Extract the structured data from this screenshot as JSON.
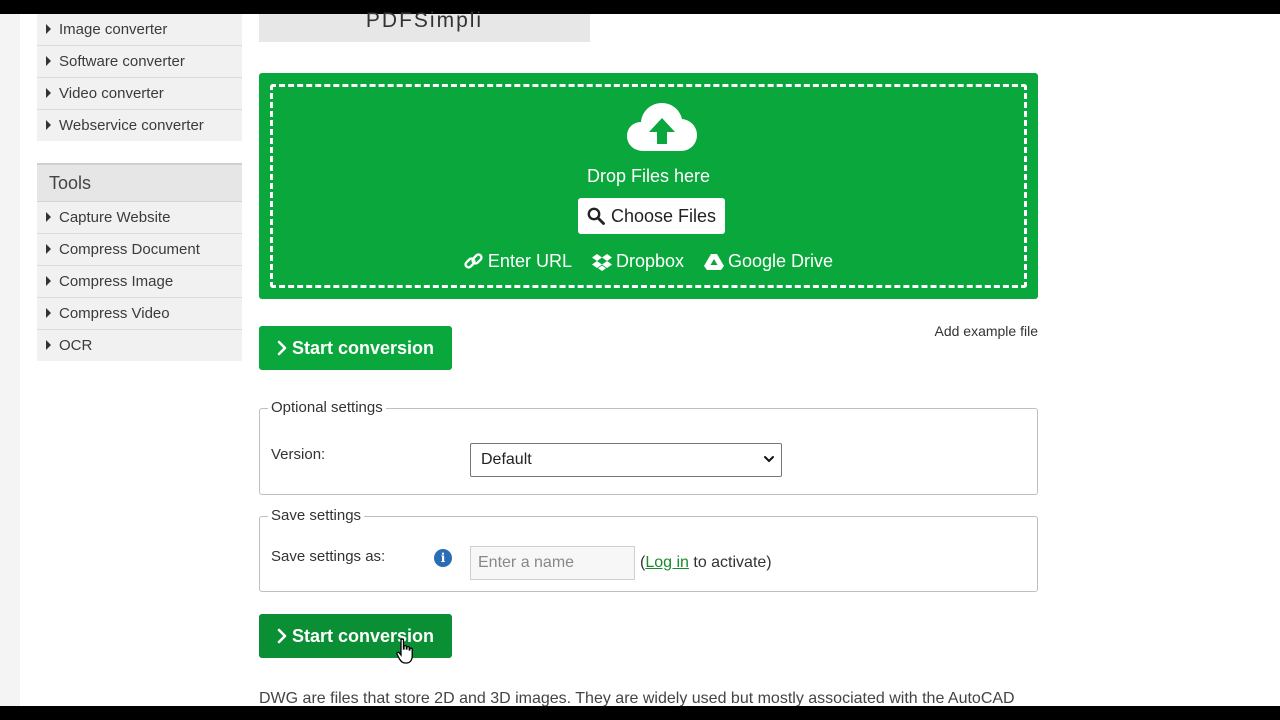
{
  "sidebar": {
    "converters": [
      {
        "label": "Image converter"
      },
      {
        "label": "Software converter"
      },
      {
        "label": "Video converter"
      },
      {
        "label": "Webservice converter"
      }
    ],
    "tools_heading": "Tools",
    "tools": [
      {
        "label": "Capture Website"
      },
      {
        "label": "Compress Document"
      },
      {
        "label": "Compress Image"
      },
      {
        "label": "Compress Video"
      },
      {
        "label": "OCR"
      }
    ]
  },
  "banner": {
    "text": "PDFSimpli"
  },
  "upload": {
    "drop_text": "Drop Files here",
    "choose_label": "Choose Files",
    "sources": {
      "url": "Enter URL",
      "dropbox": "Dropbox",
      "gdrive": "Google Drive"
    }
  },
  "actions": {
    "start_label": "Start conversion",
    "add_example": "Add example file"
  },
  "optional_settings": {
    "legend": "Optional settings",
    "version_label": "Version:",
    "version_value": "Default"
  },
  "save_settings": {
    "legend": "Save settings",
    "label": "Save settings as:",
    "placeholder": "Enter a name",
    "paren_open": "(",
    "login_link": "Log in",
    "login_suffix": " to activate)"
  },
  "description": "DWG are files that store 2D and 3D images. They are widely used but mostly associated with the AutoCAD",
  "colors": {
    "accent": "#0aa83c",
    "link": "#1a8a2c"
  }
}
